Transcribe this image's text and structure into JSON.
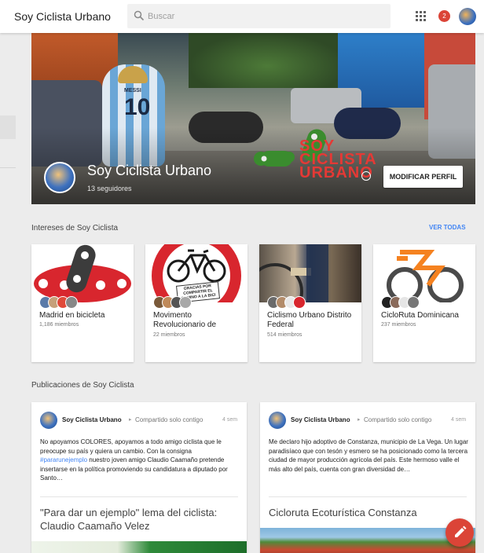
{
  "header": {
    "app_title": "Soy Ciclista Urbano",
    "search_placeholder": "Buscar",
    "notifications_count": "2"
  },
  "profile": {
    "name": "Soy Ciclista Urbano",
    "followers": "13 seguidores",
    "edit_button": "MODIFICAR PERFIL",
    "cover_logo_text": "SOY CICLISTA URBANO",
    "cover_jersey_name": "MESSI",
    "cover_jersey_number": "10"
  },
  "interests": {
    "title": "Intereses de Soy Ciclista",
    "see_all": "VER TODAS",
    "cards": [
      {
        "name": "Madrid en bicicleta",
        "count": "1,186 miembros"
      },
      {
        "name": "Movimento Revolucionario de",
        "count": "22 miembros",
        "image_text": "GRACIAS POR COMPARTIR EL CAMINO A LA BICI"
      },
      {
        "name": "Ciclismo Urbano Distrito Federal",
        "count": "514 miembros"
      },
      {
        "name": "CicloRuta Dominicana",
        "count": "237 miembros"
      }
    ]
  },
  "posts": {
    "title": "Publicaciones de Soy Ciclista",
    "items": [
      {
        "author": "Soy Ciclista Urbano",
        "share": "Compartido solo contigo",
        "time": "4 sem",
        "body_before": "No apoyamos COLORES, apoyamos a todo amigo ciclista que le preocupe su país y quiera un cambio. Con la consigna ",
        "hashtag": "#pararunejemplo",
        "body_after": " nuestro joven amigo Claudio Caamaño pretende insertarse en la política promoviendo su candidatura a diputado por Santo…",
        "link_title": "\"Para dar un ejemplo\" lema del ciclista: Claudio Caamaño Velez"
      },
      {
        "author": "Soy Ciclista Urbano",
        "share": "Compartido solo contigo",
        "time": "4 sem",
        "body": "Me declaro hijo adoptivo de Constanza, municipio de La Vega. Un lugar paradisíaco que con tesón y esmero se ha posicionado como la tercera ciudad de mayor producción agrícola del país. Este hermoso valle el más alto del país, cuenta con gran diversidad de…",
        "link_title": "Cicloruta Ecoturística Constanza"
      }
    ]
  },
  "icons": {
    "search": "search-icon",
    "apps": "apps-grid-icon",
    "compose": "pencil-icon",
    "caret": "chevron-right-icon"
  },
  "colors": {
    "accent_blue": "#4285f4",
    "notification_red": "#db4437",
    "fab_red": "#db4437"
  }
}
